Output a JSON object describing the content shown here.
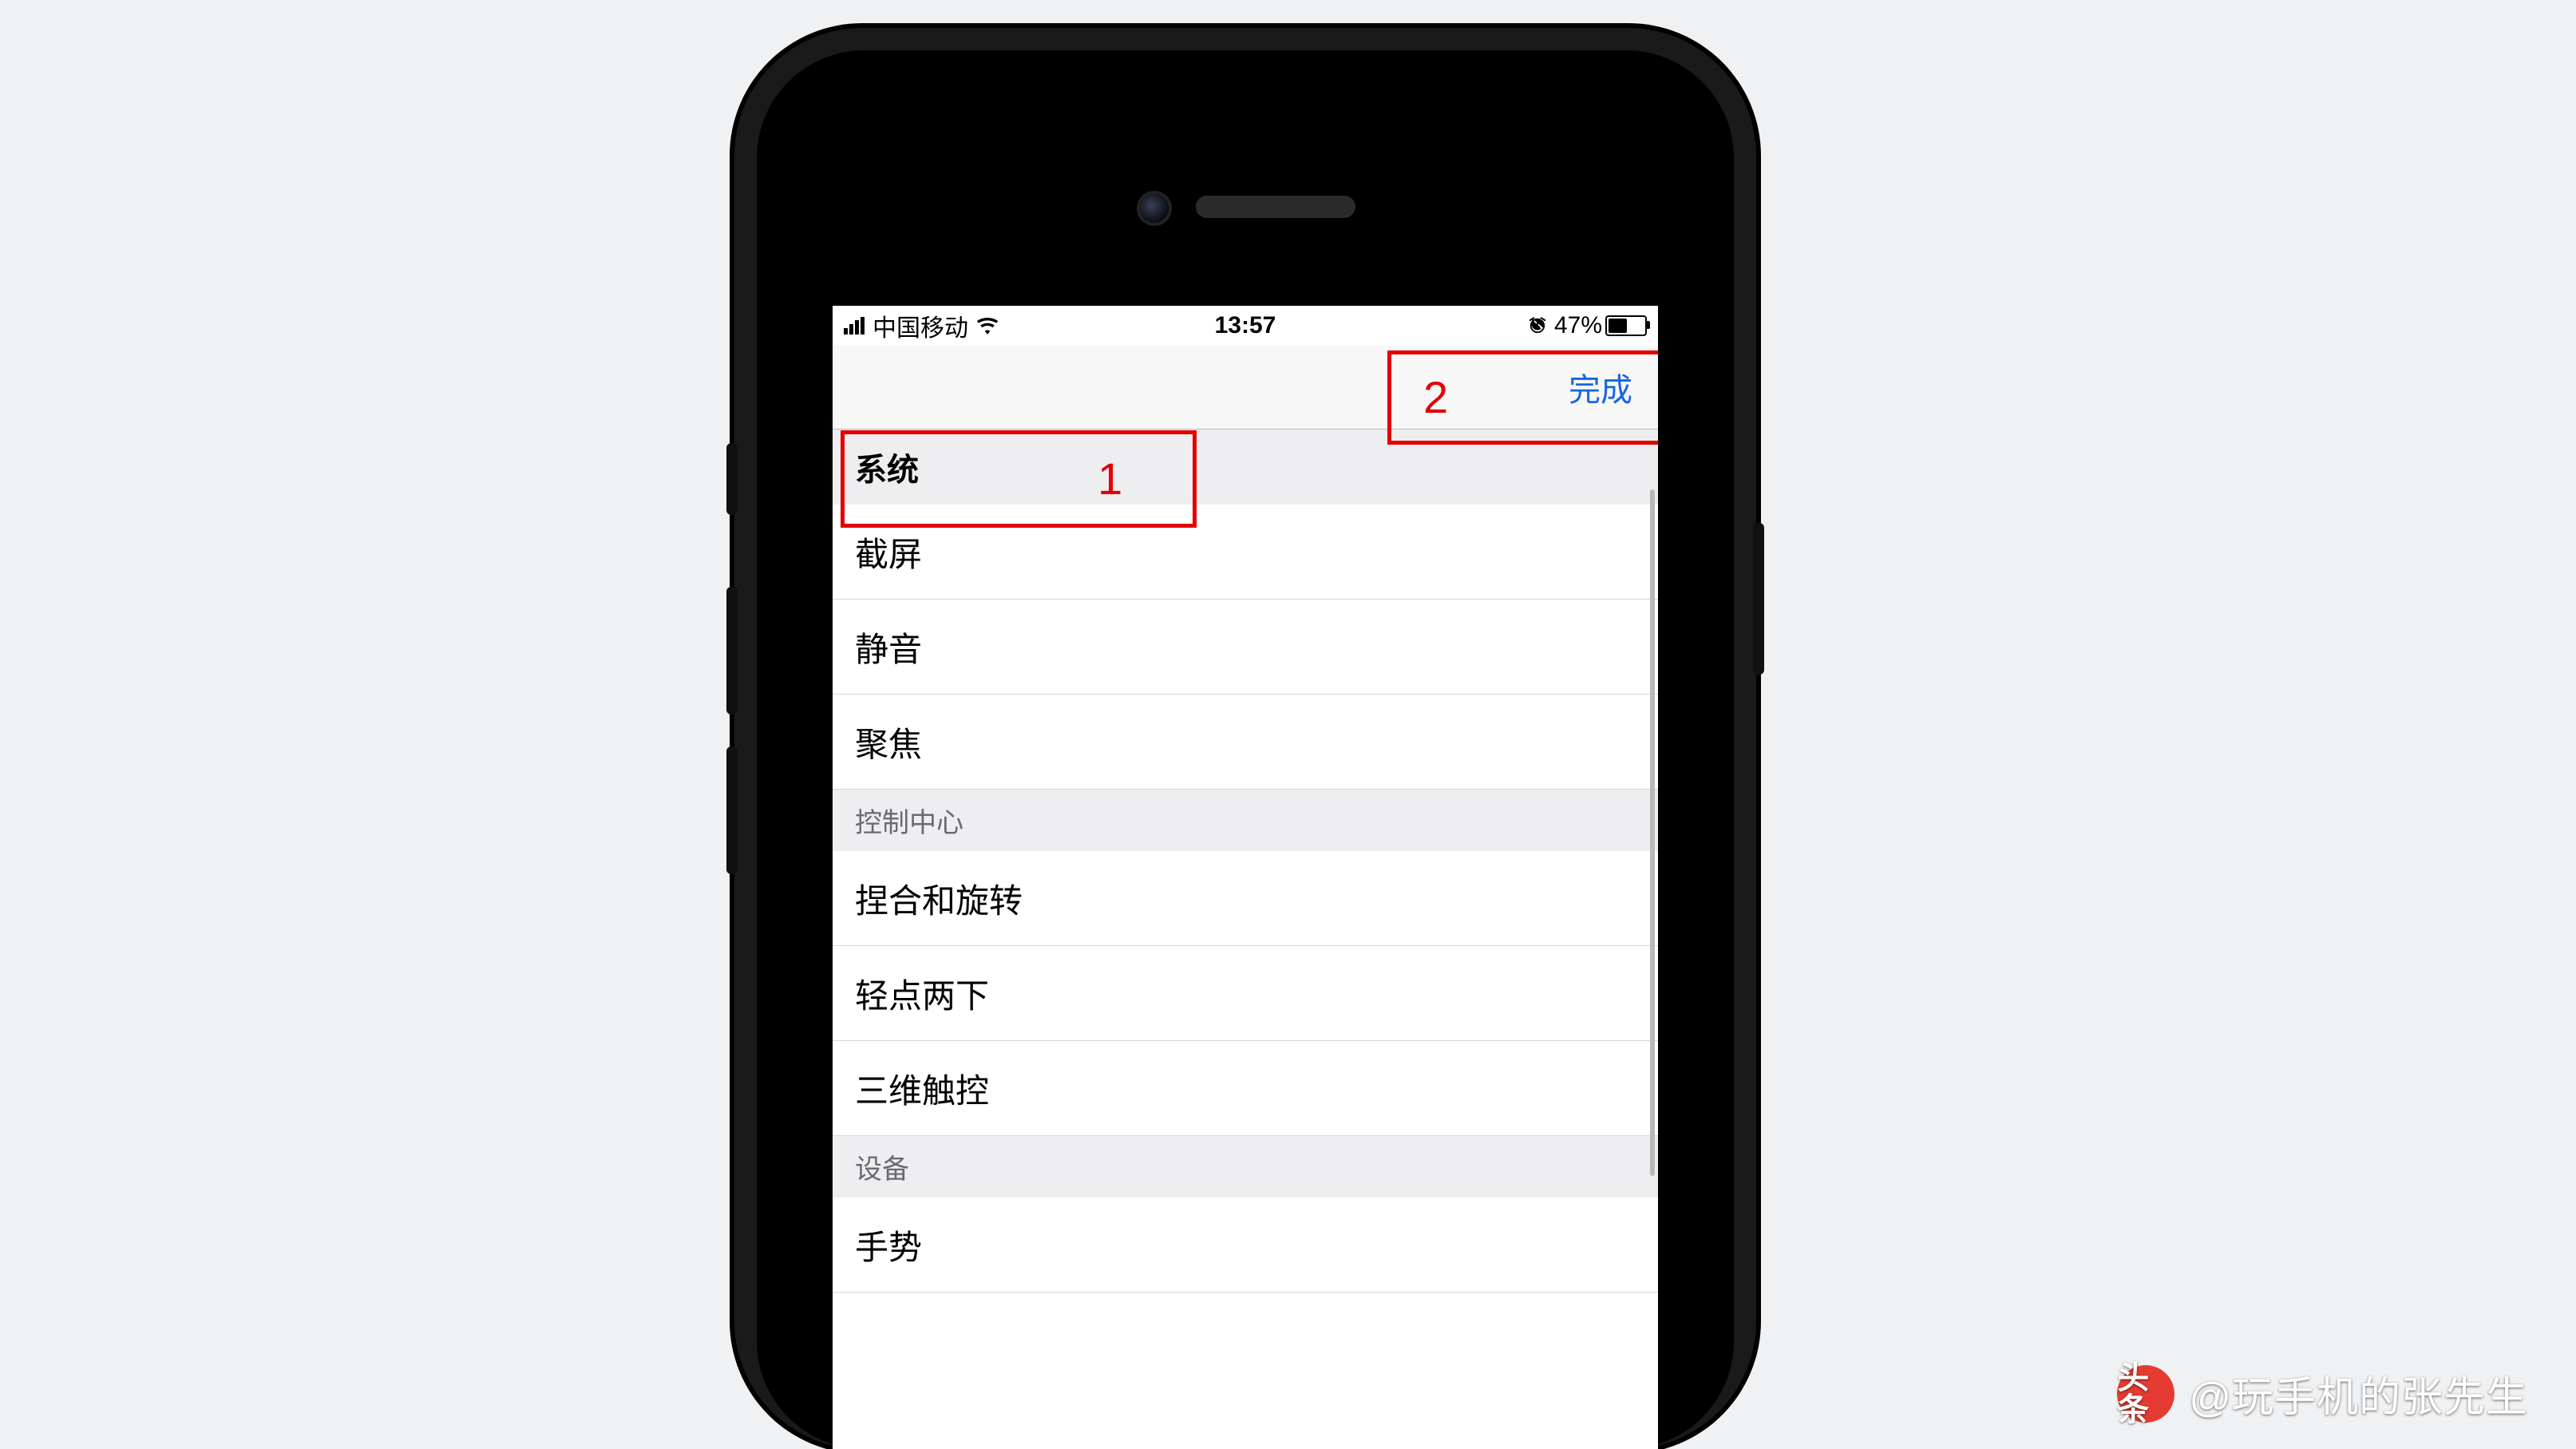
{
  "status_bar": {
    "carrier": "中国移动",
    "time": "13:57",
    "battery_pct": "47%"
  },
  "nav": {
    "done_label": "完成"
  },
  "sections": [
    {
      "header": "系统",
      "rows": [
        "截屏",
        "静音",
        "聚焦"
      ]
    },
    {
      "header": "控制中心",
      "rows": [
        "捏合和旋转",
        "轻点两下",
        "三维触控"
      ]
    },
    {
      "header": "设备",
      "rows": [
        "手势"
      ]
    }
  ],
  "annotations": {
    "one": "1",
    "two": "2"
  },
  "watermark": {
    "badge": "头条",
    "text": "@玩手机的张先生"
  }
}
